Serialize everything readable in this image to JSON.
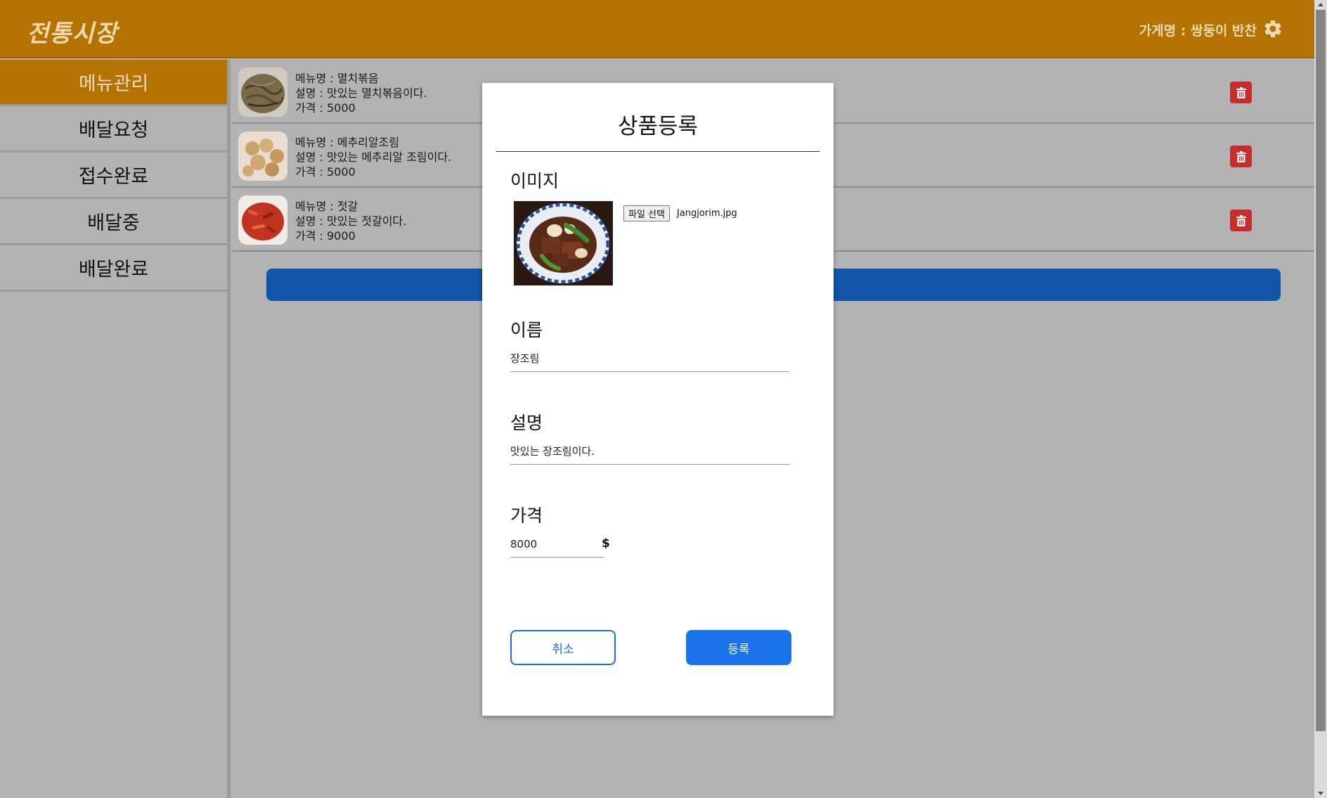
{
  "header": {
    "logo": "전통시장",
    "store_name": "가게명 : 쌍둥이 반찬",
    "settings_icon": "gear-icon"
  },
  "sidebar": {
    "items": [
      {
        "label": "메뉴관리",
        "active": true
      },
      {
        "label": "배달요청"
      },
      {
        "label": "접수완료"
      },
      {
        "label": "배달중"
      },
      {
        "label": "배달완료"
      }
    ]
  },
  "menu_list": [
    {
      "name": "메뉴명 : 멸치볶음",
      "desc": "설명 : 맛있는 멸치볶음이다.",
      "price": "가격 : 5000"
    },
    {
      "name": "메뉴명 : 메추리알조림",
      "desc": "설명 : 맛있는 메추리알 조림이다.",
      "price": "가격 : 5000"
    },
    {
      "name": "메뉴명 : 젓갈",
      "desc": "설명 : 맛있는 젓갈이다.",
      "price": "가격 : 9000"
    }
  ],
  "modal": {
    "title": "상품등록",
    "image_label": "이미지",
    "file_button": "파일 선택",
    "file_name": "Jangjorim.jpg",
    "name_label": "이름",
    "name_value": "장조림",
    "desc_label": "설명",
    "desc_value": "맛있는 장조림이다.",
    "price_label": "가격",
    "price_value": "8000",
    "currency": "$",
    "cancel": "취소",
    "submit": "등록"
  },
  "colors": {
    "brand": "#b47300",
    "primary": "#1a73e8",
    "danger": "#c82d2d"
  }
}
